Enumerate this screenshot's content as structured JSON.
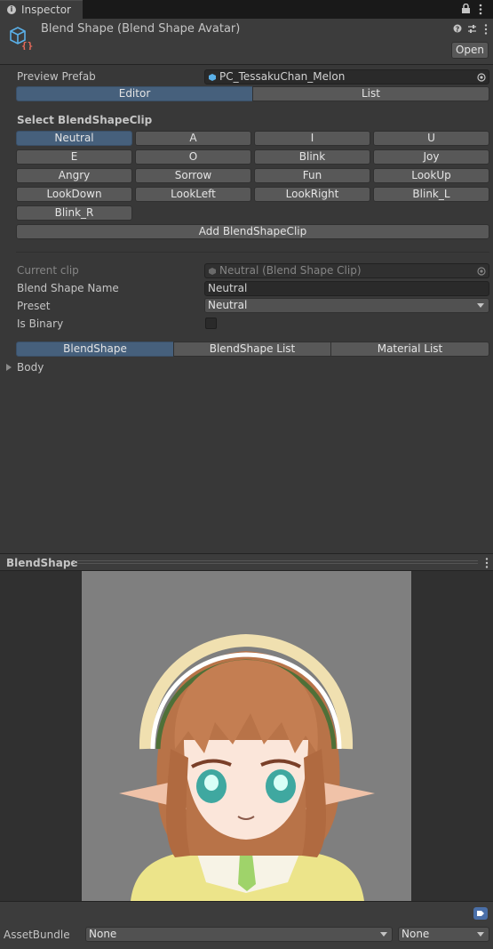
{
  "window": {
    "tab_label": "Inspector"
  },
  "header": {
    "title": "Blend Shape (Blend Shape Avatar)",
    "open_label": "Open"
  },
  "preview_prefab": {
    "label": "Preview Prefab",
    "value": "PC_TessakuChan_Melon"
  },
  "mode_tabs": [
    "Editor",
    "List"
  ],
  "select_clip": {
    "heading": "Select BlendShapeClip",
    "clips": [
      "Neutral",
      "A",
      "I",
      "U",
      "E",
      "O",
      "Blink",
      "Joy",
      "Angry",
      "Sorrow",
      "Fun",
      "LookUp",
      "LookDown",
      "LookLeft",
      "LookRight",
      "Blink_L",
      "Blink_R"
    ],
    "selected": "Neutral",
    "add_label": "Add BlendShapeClip"
  },
  "current_clip": {
    "label": "Current clip",
    "value": "Neutral (Blend Shape Clip)"
  },
  "blend_shape_name": {
    "label": "Blend Shape Name",
    "value": "Neutral"
  },
  "preset": {
    "label": "Preset",
    "value": "Neutral"
  },
  "is_binary": {
    "label": "Is Binary",
    "checked": false
  },
  "sub_tabs": [
    "BlendShape",
    "BlendShape List",
    "Material List"
  ],
  "tree": {
    "item": "Body"
  },
  "preview_panel": {
    "title": "BlendShape"
  },
  "footer": {
    "asset_bundle_label": "AssetBundle",
    "bundle_value": "None",
    "variant_value": "None"
  },
  "colors": {
    "accent": "#46607c",
    "background": "#383838",
    "tag_icon": "#4a6fa8"
  }
}
